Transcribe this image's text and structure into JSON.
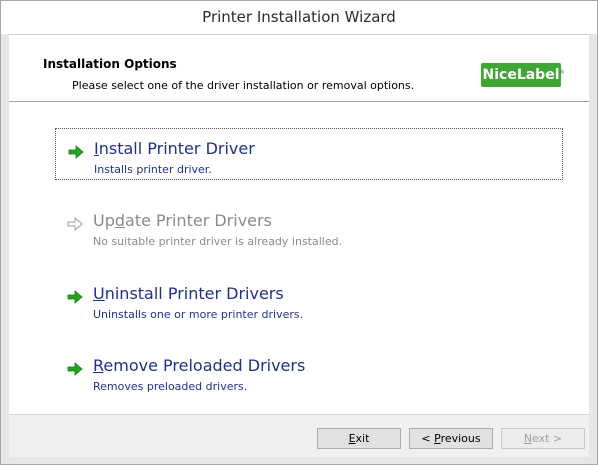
{
  "window": {
    "title": "Printer Installation Wizard"
  },
  "header": {
    "title": "Installation Options",
    "subtitle": "Please select one of the driver installation or removal options.",
    "logo": {
      "text_nice": "Nice",
      "text_label": "Label",
      "reg_mark": "®"
    }
  },
  "options": [
    {
      "title_pre": "",
      "title_key": "I",
      "title_post": "nstall Printer Driver",
      "description": "Installs printer driver.",
      "enabled": true,
      "selected": true,
      "icon": "green-arrow-icon"
    },
    {
      "title_pre": "Up",
      "title_key": "d",
      "title_post": "ate Printer Drivers",
      "description": "No suitable printer driver is already installed.",
      "enabled": false,
      "selected": false,
      "icon": "gray-arrow-icon"
    },
    {
      "title_pre": "",
      "title_key": "U",
      "title_post": "ninstall Printer Drivers",
      "description": "Uninstalls one or more printer drivers.",
      "enabled": true,
      "selected": false,
      "icon": "green-arrow-icon"
    },
    {
      "title_pre": "",
      "title_key": "R",
      "title_post": "emove Preloaded Drivers",
      "description": "Removes preloaded drivers.",
      "enabled": true,
      "selected": false,
      "icon": "green-arrow-icon"
    }
  ],
  "footer": {
    "exit_key": "E",
    "exit_rest": "xit",
    "previous_pre": "< ",
    "previous_key": "P",
    "previous_rest": "revious",
    "next_key": "N",
    "next_rest": "ext >"
  },
  "colors": {
    "accent_text": "#1e3287",
    "logo_green": "#3fa535",
    "arrow_green": "#22a81c",
    "disabled_text": "#8a8a8a"
  }
}
